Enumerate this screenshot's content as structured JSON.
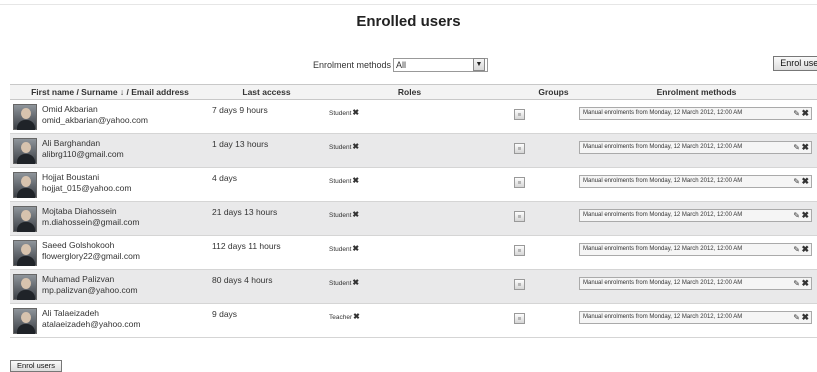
{
  "page": {
    "title": "Enrolled users"
  },
  "filter": {
    "label": "Enrolment methods",
    "selected": "All",
    "arrow_icon": "dropdown-arrow-icon"
  },
  "buttons": {
    "enrol_top": "Enrol users",
    "enrol_bottom": "Enrol users"
  },
  "table": {
    "headers": {
      "user": "First name / Surname ↓ / Email address",
      "access": "Last access",
      "roles": "Roles",
      "groups": "Groups",
      "methods": "Enrolment methods"
    },
    "rows": [
      {
        "name": "Omid Akbarian",
        "email": "omid_akbarian@yahoo.com",
        "last_access": "7 days 9 hours",
        "role": "Student",
        "method": "Manual enrolments from Monday, 12 March 2012, 12:00 AM"
      },
      {
        "name": "Ali Barghandan",
        "email": "alibrg110@gmail.com",
        "last_access": "1 day 13 hours",
        "role": "Student",
        "method": "Manual enrolments from Monday, 12 March 2012, 12:00 AM"
      },
      {
        "name": "Hojjat Boustani",
        "email": "hojjat_015@yahoo.com",
        "last_access": "4 days",
        "role": "Student",
        "method": "Manual enrolments from Monday, 12 March 2012, 12:00 AM"
      },
      {
        "name": "Mojtaba Diahossein",
        "email": "m.diahossein@gmail.com",
        "last_access": "21 days 13 hours",
        "role": "Student",
        "method": "Manual enrolments from Monday, 12 March 2012, 12:00 AM"
      },
      {
        "name": "Saeed Golshokooh",
        "email": "flowerglory22@gmail.com",
        "last_access": "112 days 11 hours",
        "role": "Student",
        "method": "Manual enrolments from Monday, 12 March 2012, 12:00 AM"
      },
      {
        "name": "Muhamad Palizvan",
        "email": "mp.palizvan@yahoo.com",
        "last_access": "80 days 4 hours",
        "role": "Student",
        "method": "Manual enrolments from Monday, 12 March 2012, 12:00 AM"
      },
      {
        "name": "Ali Talaeizadeh",
        "email": "atalaeizadeh@yahoo.com",
        "last_access": "9 days",
        "role": "Teacher",
        "method": "Manual enrolments from Monday, 12 March 2012, 12:00 AM"
      }
    ]
  },
  "icons": {
    "remove": "✖",
    "edit": "✎",
    "remove_role": "close-icon",
    "edit_enrolment": "edit-icon"
  }
}
